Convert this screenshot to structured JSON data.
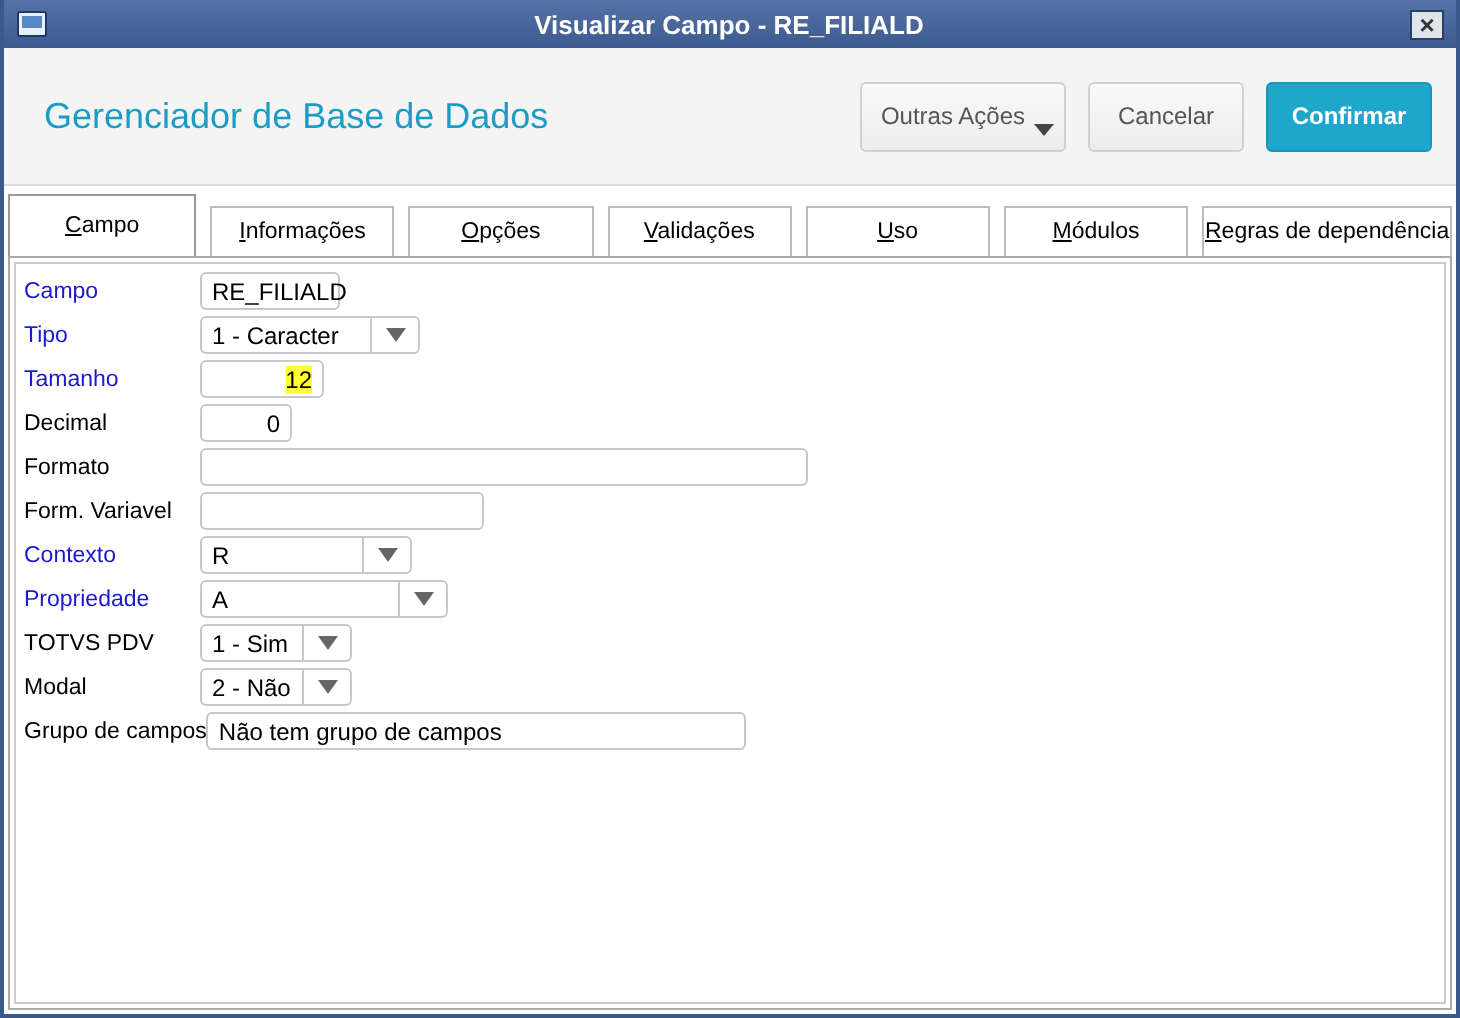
{
  "window": {
    "title": "Visualizar Campo - RE_FILIALD",
    "close": "×"
  },
  "header": {
    "title": "Gerenciador de Base de Dados",
    "buttons": [
      {
        "label": "Outras Ações",
        "kind": "menu"
      },
      {
        "label": "Cancelar",
        "kind": "plain"
      },
      {
        "label": "Confirmar",
        "kind": "primary"
      }
    ]
  },
  "tabs": [
    {
      "label": "Campo",
      "selected": true
    },
    {
      "label": "Informações",
      "selected": false
    },
    {
      "label": "Opções",
      "selected": false
    },
    {
      "label": "Validações",
      "selected": false
    },
    {
      "label": "Uso",
      "selected": false
    },
    {
      "label": "Módulos",
      "selected": false
    },
    {
      "label": "Regras de dependência",
      "selected": false
    }
  ],
  "fields": [
    {
      "label": "Campo",
      "required": true,
      "kind": "text",
      "value": "RE_FILIALD"
    },
    {
      "label": "Tipo",
      "required": true,
      "kind": "combo",
      "value": "1 - Caracter"
    },
    {
      "label": "Tamanho",
      "required": true,
      "kind": "number",
      "value": "12",
      "highlighted": true
    },
    {
      "label": "Decimal",
      "required": false,
      "kind": "number",
      "value": "0",
      "highlighted": false
    },
    {
      "label": "Formato",
      "required": false,
      "kind": "text"
    },
    {
      "label": "Form. Variavel",
      "required": false,
      "kind": "text"
    },
    {
      "label": "Contexto",
      "required": true,
      "kind": "combo",
      "value": "R"
    },
    {
      "label": "Propriedade",
      "required": true,
      "kind": "combo",
      "value": "A"
    },
    {
      "label": "TOTVS PDV",
      "required": false,
      "kind": "combo",
      "value": "1 - Sim"
    },
    {
      "label": "Modal",
      "required": false,
      "kind": "combo",
      "value": "2 - Não"
    },
    {
      "label": "Grupo de campos",
      "required": false,
      "kind": "text",
      "value": "Não tem grupo de campos"
    }
  ]
}
